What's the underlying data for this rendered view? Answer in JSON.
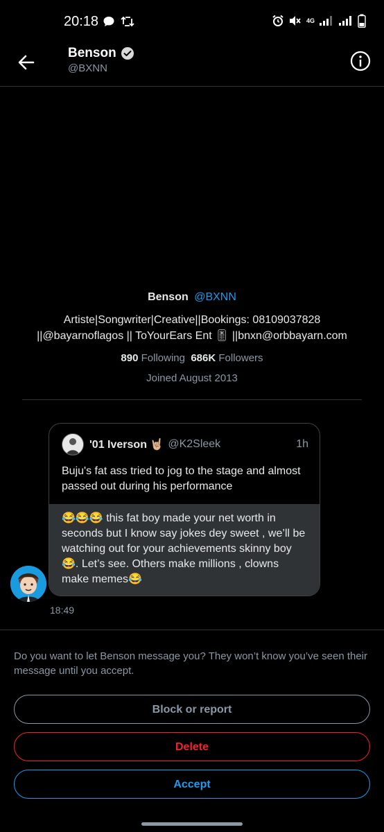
{
  "status_bar": {
    "time": "20:18",
    "network": "4G"
  },
  "header": {
    "name": "Benson",
    "handle": "@BXNN",
    "verified_icon": "verified-badge-icon",
    "back_icon": "arrow-left-icon",
    "info_icon": "info-circle-icon"
  },
  "profile": {
    "name": "Benson",
    "handle": "@BXNN",
    "bio_line1": "Artiste|Songwriter|Creative||Bookings: 08109037828",
    "bio_line2": "||@bayarnoflagos || ToYourEars Ent 🎚 ||bnxn@orbbayarn.com",
    "following_count": "890",
    "following_label": "Following",
    "followers_count": "686K",
    "followers_label": "Followers",
    "joined": "Joined August 2013"
  },
  "message": {
    "quoted": {
      "name": "'01 Iverson 🤘🏼",
      "handle": "@K2Sleek",
      "time": "1h",
      "text": "Buju's fat ass tried to jog to the stage and almost passed out during his performance"
    },
    "reply_text": "😂😂😂 this fat boy made your net worth in seconds but I know say jokes dey sweet , we’ll be watching out for your achievements skinny boy 😂. Let’s see. Others make millions , clowns make memes😂",
    "timestamp": "18:49"
  },
  "notice": "Do you want to let Benson message you? They won’t know you’ve seen their message until you accept.",
  "actions": {
    "block": "Block or report",
    "delete": "Delete",
    "accept": "Accept"
  },
  "colors": {
    "accent": "#1d9bf0",
    "danger": "#f4212e",
    "muted": "#8b98a5",
    "bubble": "#2f3336"
  }
}
